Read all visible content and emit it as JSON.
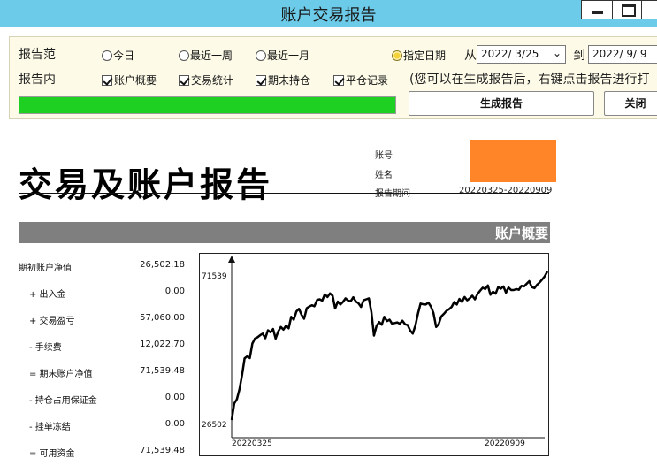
{
  "window": {
    "title": "账户交易报告"
  },
  "controls": {
    "range_label": "报告范",
    "content_label": "报告内",
    "ranges": [
      {
        "label": "今日",
        "selected": false
      },
      {
        "label": "最近一周",
        "selected": false
      },
      {
        "label": "最近一月",
        "selected": false
      },
      {
        "label": "指定日期",
        "selected": true
      }
    ],
    "from_label": "从",
    "from_date": "2022/ 3/25",
    "to_label": "到",
    "to_date": "2022/ 9/ 9",
    "contents": [
      {
        "label": "账户概要",
        "checked": true
      },
      {
        "label": "交易统计",
        "checked": true
      },
      {
        "label": "期末持仓",
        "checked": true
      },
      {
        "label": "平仓记录",
        "checked": true
      }
    ],
    "hint": "(您可以在生成报告后，右键点击报告进行打",
    "progress": 1.0,
    "generate_label": "生成报告",
    "close_label": "关闭"
  },
  "report": {
    "title": "交易及账户报告",
    "account_label": "账号",
    "name_label": "姓名",
    "period_label": "报告期间",
    "period_value": "20220325-20220909",
    "section_title": "账户概要",
    "summary": [
      {
        "name": "期初账户净值",
        "value": "26,502.18"
      },
      {
        "name": "+ 出入金",
        "value": "0.00"
      },
      {
        "name": "+ 交易盈亏",
        "value": "57,060.00"
      },
      {
        "name": "- 手续费",
        "value": "12,022.70"
      },
      {
        "name": "= 期末账户净值",
        "value": "71,539.48"
      },
      {
        "name": "- 持仓占用保证金",
        "value": "0.00"
      },
      {
        "name": "- 挂单冻结",
        "value": "0.00"
      },
      {
        "name": "= 可用资金",
        "value": "71,539.48"
      }
    ]
  },
  "chart_data": {
    "type": "line",
    "title": "",
    "xlabel": "",
    "ylabel": "",
    "x_start_label": "20220325",
    "x_end_label": "20220909",
    "y_min_label": "26502",
    "y_max_label": "71539",
    "ylim": [
      26502,
      71539
    ],
    "series": [
      {
        "values": [
          26502,
          31500,
          32800,
          35800,
          40100,
          45200,
          45800,
          45300,
          49700,
          51200,
          51600,
          52200,
          52700,
          51300,
          53700,
          53100,
          54100,
          51200,
          53400,
          54700,
          53900,
          55100,
          54300,
          57800,
          56900,
          59400,
          60200,
          58400,
          57200,
          60400,
          60900,
          61300,
          61000,
          62900,
          63100,
          62700,
          64600,
          63800,
          64900,
          64200,
          60300,
          62400,
          61500,
          62300,
          63400,
          62700,
          62500,
          63700,
          62400,
          61900,
          60800,
          62800,
          63100,
          63400,
          59200,
          52100,
          55100,
          56200,
          55400,
          57800,
          56500,
          56900,
          55700,
          55900,
          56100,
          55700,
          56600,
          55500,
          55300,
          53600,
          52700,
          55200,
          58800,
          61800,
          61600,
          61500,
          62100,
          60900,
          58900,
          54700,
          55600,
          57900,
          58700,
          59600,
          60100,
          60800,
          62300,
          61500,
          63200,
          62300,
          63800,
          62800,
          63400,
          64200,
          63100,
          64700,
          65700,
          66600,
          66200,
          67300,
          64500,
          65400,
          64800,
          66800,
          66300,
          67000,
          65100,
          66700,
          65900,
          65900,
          66200,
          66000,
          67200,
          67000,
          67800,
          68600,
          66800,
          66500,
          67500,
          68200,
          69100,
          70100,
          71539
        ]
      }
    ]
  }
}
